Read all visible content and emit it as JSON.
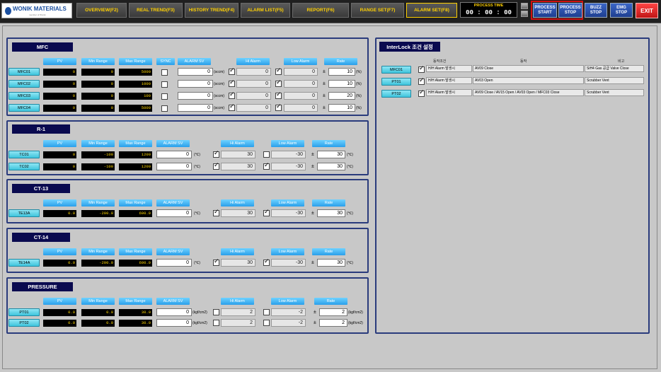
{
  "header": {
    "logo_text": "WONIK MATERIALS",
    "logo_sub": "member of Wonik",
    "nav": [
      "OVERVIEW(F2)",
      "REAL TREND(F3)",
      "HISTORY TREND(F4)",
      "ALARM LIST(F5)",
      "REPORT(F6)",
      "RANGE SET(F7)",
      "ALARM SET(F8)"
    ],
    "process_time_label": "PROCESS TIME",
    "process_time_value": "00 : 00 : 00",
    "process_start": "PROCESS\nSTART",
    "process_stop": "PROCESS\nSTOP",
    "buzz_stop": "BUZZ\nSTOP",
    "emg_stop": "EMG\nSTOP",
    "exit": "EXIT"
  },
  "headers": {
    "pv": "PV",
    "min": "Min Range",
    "max": "Max Range",
    "sync": "SYNC",
    "alarm_sv": "ALARM SV",
    "hi": "Hi Alarm",
    "low": "Low Alarm",
    "rate": "Rate"
  },
  "sections": {
    "mfc": {
      "title": "MFC",
      "rows": [
        {
          "tag": "MFC01",
          "pv": "0",
          "min": "0",
          "max": "5000",
          "sv": "0",
          "unit": "(sccm)",
          "hi_on": true,
          "hi": "0",
          "low_on": true,
          "low": "0",
          "rate": "10",
          "rate_unit": "(%)"
        },
        {
          "tag": "MFC02",
          "pv": "0",
          "min": "0",
          "max": "1000",
          "sv": "0",
          "unit": "(sccm)",
          "hi_on": true,
          "hi": "0",
          "low_on": true,
          "low": "0",
          "rate": "10",
          "rate_unit": "(%)"
        },
        {
          "tag": "MFC03",
          "pv": "0",
          "min": "0",
          "max": "100",
          "sv": "0",
          "unit": "(sccm)",
          "hi_on": true,
          "hi": "0",
          "low_on": true,
          "low": "0",
          "rate": "20",
          "rate_unit": "(%)"
        },
        {
          "tag": "MFC04",
          "pv": "0",
          "min": "0",
          "max": "5000",
          "sv": "0",
          "unit": "(sccm)",
          "hi_on": true,
          "hi": "0",
          "low_on": true,
          "low": "0",
          "rate": "10",
          "rate_unit": "(%)"
        }
      ]
    },
    "r1": {
      "title": "R-1",
      "rows": [
        {
          "tag": "TC01",
          "pv": "0",
          "min": "-100",
          "max": "1200",
          "sv": "0",
          "unit": "(℃)",
          "hi_on": true,
          "hi": "30",
          "low_on": false,
          "low": "-30",
          "rate": "30",
          "rate_unit": "(℃)"
        },
        {
          "tag": "TC02",
          "pv": "0",
          "min": "-100",
          "max": "1200",
          "sv": "0",
          "unit": "(℃)",
          "hi_on": true,
          "hi": "30",
          "low_on": true,
          "low": "-30",
          "rate": "30",
          "rate_unit": "(℃)"
        }
      ]
    },
    "ct13": {
      "title": "CT-13",
      "rows": [
        {
          "tag": "TE13A",
          "pv": "0.0",
          "min": "-200.0",
          "max": "600.0",
          "sv": "0",
          "unit": "(℃)",
          "hi_on": true,
          "hi": "30",
          "low_on": true,
          "low": "-30",
          "rate": "30",
          "rate_unit": "(℃)"
        }
      ]
    },
    "ct14": {
      "title": "CT-14",
      "rows": [
        {
          "tag": "TE14A",
          "pv": "0.0",
          "min": "-200.0",
          "max": "600.0",
          "sv": "0",
          "unit": "(℃)",
          "hi_on": true,
          "hi": "30",
          "low_on": true,
          "low": "-30",
          "rate": "30",
          "rate_unit": "(℃)"
        }
      ]
    },
    "pressure": {
      "title": "PRESSURE",
      "rows": [
        {
          "tag": "PT01",
          "pv": "0.0",
          "min": "0.0",
          "max": "30.0",
          "sv": "0",
          "unit": "(kgf/cm2)",
          "hi_on": false,
          "hi": "2",
          "low_on": false,
          "low": "-2",
          "rate": "2",
          "rate_unit": "(kgf/cm2)"
        },
        {
          "tag": "PT02",
          "pv": "0.0",
          "min": "0.0",
          "max": "30.0",
          "sv": "0",
          "unit": "(kgf/cm2)",
          "hi_on": false,
          "hi": "2",
          "low_on": false,
          "low": "-2",
          "rate": "2",
          "rate_unit": "(kgf/cm2)"
        }
      ]
    }
  },
  "interlock": {
    "title": "InterLock 조건 설정",
    "col_condition": "동작조건",
    "col_action": "동작",
    "col_note": "비고",
    "rows": [
      {
        "tag": "MFC01",
        "checked": true,
        "condition": "H/H Alarm 발생시",
        "action": "AV09 Close",
        "note": "SiH4 Gas 공급 Valve Close"
      },
      {
        "tag": "PT01",
        "checked": true,
        "condition": "H/H Alarm 발생시",
        "action": "AV03 Open",
        "note": "Scrubber Vent"
      },
      {
        "tag": "PT02",
        "checked": true,
        "condition": "H/H Alarm 발생시",
        "action": "AV09 Close / AV15 Open / AV03 Open / MFC03 Close",
        "note": "Scrubber Vent"
      }
    ]
  },
  "colors": {
    "panel_border": "#2a3b7c",
    "title_bg": "#0a0a4f",
    "header_btn": "#2a9fea",
    "row_btn": "#3fc4dc",
    "nav_text": "#ffd000",
    "exit": "#e02020"
  }
}
